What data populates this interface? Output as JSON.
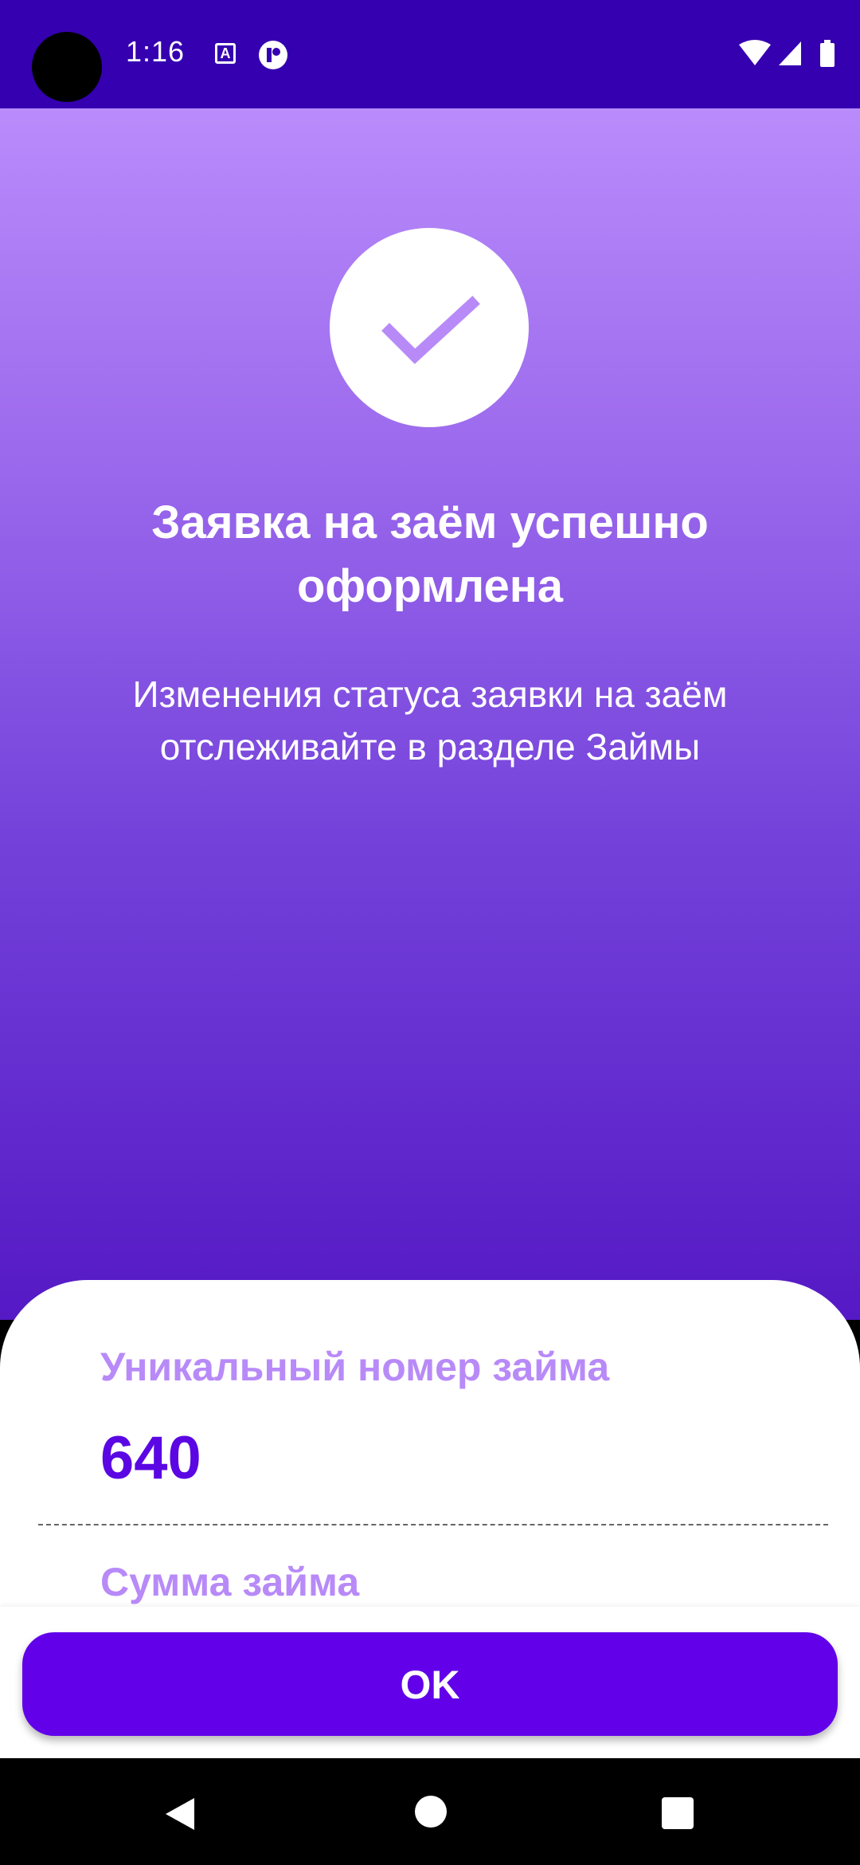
{
  "status_bar": {
    "time": "1:16",
    "notification_icon_a_letter": "A",
    "icons": [
      "camera-icon",
      "text-notification-icon",
      "app-notification-icon",
      "wifi-icon",
      "signal-icon",
      "battery-icon"
    ]
  },
  "hero": {
    "icon": "checkmark-icon",
    "title": "Заявка на заём успешно оформлена",
    "subtitle": "Изменения статуса заявки на заём отслеживайте в разделе Займы"
  },
  "details": {
    "loan_number_label": "Уникальный номер займа",
    "loan_number_value": "640",
    "loan_sum_label": "Сумма займа"
  },
  "actions": {
    "ok_label": "OK"
  },
  "nav": {
    "icons": [
      "back-icon",
      "home-icon",
      "recents-icon"
    ]
  },
  "colors": {
    "status_bar": "#3500b0",
    "gradient_top": "#b98bfb",
    "gradient_bottom": "#5519c5",
    "accent": "#6200ea",
    "label": "#b88af8",
    "value": "#5b07e3"
  }
}
